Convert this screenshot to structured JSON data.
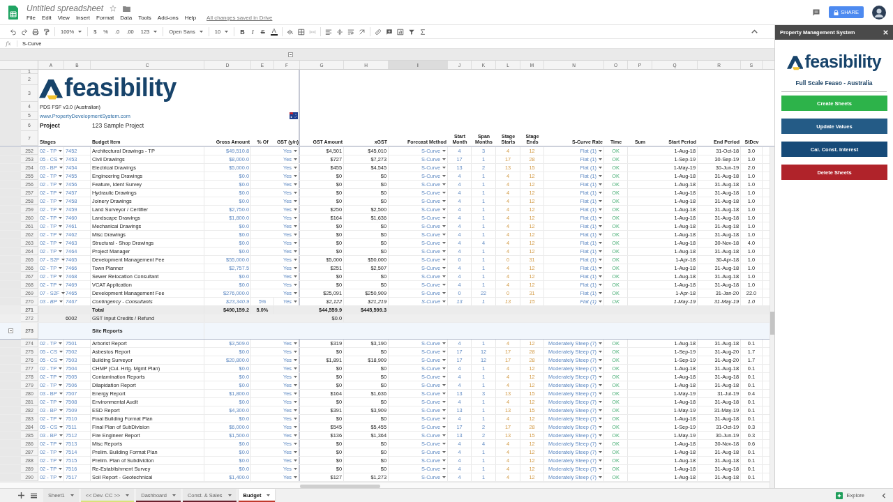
{
  "app": {
    "title": "Untitled spreadsheet",
    "menus": [
      "File",
      "Edit",
      "View",
      "Insert",
      "Format",
      "Data",
      "Tools",
      "Add-ons",
      "Help"
    ],
    "save_status": "All changes saved in Drive",
    "share": "SHARE"
  },
  "toolbar": [
    {
      "kind": "undo"
    },
    {
      "kind": "redo"
    },
    {
      "kind": "print"
    },
    {
      "kind": "paint-format"
    },
    {
      "kind": "sep"
    },
    {
      "kind": "menu",
      "label": "100%"
    },
    {
      "kind": "sep"
    },
    {
      "kind": "text",
      "label": "$"
    },
    {
      "kind": "text",
      "label": "%"
    },
    {
      "kind": "text",
      "label": ".0"
    },
    {
      "kind": "text",
      "label": ".00"
    },
    {
      "kind": "menu",
      "label": "123"
    },
    {
      "kind": "sep"
    },
    {
      "kind": "menu",
      "label": "Open Sans"
    },
    {
      "kind": "sep"
    },
    {
      "kind": "menu",
      "label": "10"
    },
    {
      "kind": "sep"
    },
    {
      "kind": "bold",
      "label": "B"
    },
    {
      "kind": "italic",
      "label": "I"
    },
    {
      "kind": "strike",
      "label": "S"
    },
    {
      "kind": "textcolor",
      "label": "A"
    },
    {
      "kind": "sep"
    },
    {
      "kind": "fill"
    },
    {
      "kind": "borders"
    },
    {
      "kind": "merge"
    },
    {
      "kind": "sep"
    },
    {
      "kind": "halign"
    },
    {
      "kind": "valign"
    },
    {
      "kind": "wrap"
    },
    {
      "kind": "rotate"
    },
    {
      "kind": "sep"
    },
    {
      "kind": "link"
    },
    {
      "kind": "comment"
    },
    {
      "kind": "chart"
    },
    {
      "kind": "filter"
    },
    {
      "kind": "functions"
    }
  ],
  "formula_bar": {
    "label": "fx",
    "value": "S-Curve"
  },
  "columns": [
    {
      "letter": "A",
      "kind": "input",
      "dropdown": true,
      "selected": false
    },
    {
      "letter": "B",
      "kind": "input",
      "dropdown": false,
      "selected": false
    },
    {
      "letter": "C",
      "kind": "plain",
      "dropdown": false,
      "selected": false
    },
    {
      "letter": "D",
      "kind": "input",
      "dropdown": false,
      "selected": false
    },
    {
      "letter": "E",
      "kind": "input",
      "dropdown": false,
      "selected": false
    },
    {
      "letter": "F",
      "kind": "input",
      "dropdown": true,
      "selected": false
    },
    {
      "letter": "G",
      "kind": "plain",
      "dropdown": false,
      "selected": false
    },
    {
      "letter": "H",
      "kind": "plain",
      "dropdown": false,
      "selected": false
    },
    {
      "letter": "I",
      "kind": "input",
      "dropdown": true,
      "selected": true
    },
    {
      "letter": "J",
      "kind": "input",
      "dropdown": false,
      "selected": false
    },
    {
      "letter": "K",
      "kind": "input",
      "dropdown": false,
      "selected": false
    },
    {
      "letter": "L",
      "kind": "stage",
      "dropdown": false,
      "selected": false
    },
    {
      "letter": "M",
      "kind": "stage",
      "dropdown": false,
      "selected": false
    },
    {
      "letter": "N",
      "kind": "input",
      "dropdown": true,
      "selected": false
    },
    {
      "letter": "O",
      "kind": "status",
      "dropdown": false,
      "selected": false
    },
    {
      "letter": "P",
      "selected": false
    },
    {
      "letter": "Q",
      "kind": "plain",
      "dropdown": false,
      "selected": false
    },
    {
      "letter": "R",
      "kind": "plain",
      "dropdown": false,
      "selected": false
    },
    {
      "letter": "S",
      "kind": "plain",
      "dropdown": false,
      "selected": false
    }
  ],
  "sheet_header": {
    "row_numbers": [
      "1",
      "2",
      "3",
      "4",
      "5",
      "6",
      "7"
    ],
    "logo": "feasibility",
    "version": "PDS FSF v3.0 (Australian)",
    "link": "www.PropertyDevelopmentSystem.com",
    "project_label": "Project",
    "project_name": "123 Sample Project",
    "headers": {
      "A": "Stages",
      "C": "Budget Item",
      "D": "Gross Amount",
      "E": "% Of",
      "F": "GST (y/n)",
      "G": "GST Amount",
      "H": "xGST",
      "I": "Forecast Method",
      "J": "Start Month",
      "K": "Span Months",
      "L": "Stage Starts",
      "M": "Stage Ends",
      "N": "S-Curve Rate",
      "O": "Time",
      "P": "Sum",
      "Q": "Start Period",
      "R": "End Period",
      "S": "StDev"
    }
  },
  "rows": [
    {
      "row": "252",
      "kind": "item",
      "italic": false,
      "cells": {
        "A": "02 - TP",
        "B": "7452",
        "C": "Architectural Drawings - TP",
        "D": "$49,510.8",
        "F": "Yes",
        "G": "$4,501",
        "H": "$45,010",
        "I": "S-Curve",
        "J": "4",
        "K": "3",
        "L": "4",
        "M": "12",
        "N": "Flat (1)",
        "O": "OK",
        "Q": "1-Aug-18",
        "R": "31-Oct-18",
        "S": "3.0"
      }
    },
    {
      "row": "253",
      "kind": "item",
      "italic": false,
      "cells": {
        "A": "05 - CS",
        "B": "7453",
        "C": "Civil Drawings",
        "D": "$8,000.0",
        "F": "Yes",
        "G": "$727",
        "H": "$7,273",
        "I": "S-Curve",
        "J": "17",
        "K": "1",
        "L": "17",
        "M": "28",
        "N": "Flat (1)",
        "O": "OK",
        "Q": "1-Sep-19",
        "R": "30-Sep-19",
        "S": "1.0"
      }
    },
    {
      "row": "254",
      "kind": "item",
      "italic": false,
      "cells": {
        "A": "03 - BP",
        "B": "7454",
        "C": "Electrical Drawings",
        "D": "$5,000.0",
        "F": "Yes",
        "G": "$455",
        "H": "$4,545",
        "I": "S-Curve",
        "J": "13",
        "K": "2",
        "L": "13",
        "M": "15",
        "N": "Flat (1)",
        "O": "OK",
        "Q": "1-May-19",
        "R": "30-Jun-19",
        "S": "2.0"
      }
    },
    {
      "row": "255",
      "kind": "item",
      "italic": false,
      "cells": {
        "A": "02 - TP",
        "B": "7455",
        "C": "Engineering Drawings",
        "D": "$0.0",
        "F": "Yes",
        "G": "$0",
        "H": "$0",
        "I": "S-Curve",
        "J": "4",
        "K": "1",
        "L": "4",
        "M": "12",
        "N": "Flat (1)",
        "O": "OK",
        "Q": "1-Aug-18",
        "R": "31-Aug-18",
        "S": "1.0"
      }
    },
    {
      "row": "256",
      "kind": "item",
      "italic": false,
      "cells": {
        "A": "02 - TP",
        "B": "7456",
        "C": "Feature, Ident Survey",
        "D": "$0.0",
        "F": "Yes",
        "G": "$0",
        "H": "$0",
        "I": "S-Curve",
        "J": "4",
        "K": "1",
        "L": "4",
        "M": "12",
        "N": "Flat (1)",
        "O": "OK",
        "Q": "1-Aug-18",
        "R": "31-Aug-18",
        "S": "1.0"
      }
    },
    {
      "row": "257",
      "kind": "item",
      "italic": false,
      "cells": {
        "A": "02 - TP",
        "B": "7457",
        "C": "Hydraulic Drawings",
        "D": "$0.0",
        "F": "Yes",
        "G": "$0",
        "H": "$0",
        "I": "S-Curve",
        "J": "4",
        "K": "1",
        "L": "4",
        "M": "12",
        "N": "Flat (1)",
        "O": "OK",
        "Q": "1-Aug-18",
        "R": "31-Aug-18",
        "S": "1.0"
      }
    },
    {
      "row": "258",
      "kind": "item",
      "italic": false,
      "cells": {
        "A": "02 - TP",
        "B": "7458",
        "C": "Joinery Drawings",
        "D": "$0.0",
        "F": "Yes",
        "G": "$0",
        "H": "$0",
        "I": "S-Curve",
        "J": "4",
        "K": "1",
        "L": "4",
        "M": "12",
        "N": "Flat (1)",
        "O": "OK",
        "Q": "1-Aug-18",
        "R": "31-Aug-18",
        "S": "1.0"
      }
    },
    {
      "row": "259",
      "kind": "item",
      "italic": false,
      "cells": {
        "A": "02 - TP",
        "B": "7459",
        "C": "Land Surveyor / Certifier",
        "D": "$2,750.0",
        "F": "Yes",
        "G": "$250",
        "H": "$2,500",
        "I": "S-Curve",
        "J": "4",
        "K": "1",
        "L": "4",
        "M": "12",
        "N": "Flat (1)",
        "O": "OK",
        "Q": "1-Aug-18",
        "R": "31-Aug-18",
        "S": "1.0"
      }
    },
    {
      "row": "260",
      "kind": "item",
      "italic": false,
      "cells": {
        "A": "02 - TP",
        "B": "7460",
        "C": "Landscape Drawings",
        "D": "$1,800.0",
        "F": "Yes",
        "G": "$164",
        "H": "$1,636",
        "I": "S-Curve",
        "J": "4",
        "K": "1",
        "L": "4",
        "M": "12",
        "N": "Flat (1)",
        "O": "OK",
        "Q": "1-Aug-18",
        "R": "31-Aug-18",
        "S": "1.0"
      }
    },
    {
      "row": "261",
      "kind": "item",
      "italic": false,
      "cells": {
        "A": "02 - TP",
        "B": "7461",
        "C": "Mechanical Drawings",
        "D": "$0.0",
        "F": "Yes",
        "G": "$0",
        "H": "$0",
        "I": "S-Curve",
        "J": "4",
        "K": "1",
        "L": "4",
        "M": "12",
        "N": "Flat (1)",
        "O": "OK",
        "Q": "1-Aug-18",
        "R": "31-Aug-18",
        "S": "1.0"
      }
    },
    {
      "row": "262",
      "kind": "item",
      "italic": false,
      "cells": {
        "A": "02 - TP",
        "B": "7462",
        "C": "Misc Drawings",
        "D": "$0.0",
        "F": "Yes",
        "G": "$0",
        "H": "$0",
        "I": "S-Curve",
        "J": "4",
        "K": "1",
        "L": "4",
        "M": "12",
        "N": "Flat (1)",
        "O": "OK",
        "Q": "1-Aug-18",
        "R": "31-Aug-18",
        "S": "1.0"
      }
    },
    {
      "row": "263",
      "kind": "item",
      "italic": false,
      "cells": {
        "A": "02 - TP",
        "B": "7463",
        "C": "Structural - Shop Drawings",
        "D": "$0.0",
        "F": "Yes",
        "G": "$0",
        "H": "$0",
        "I": "S-Curve",
        "J": "4",
        "K": "4",
        "L": "4",
        "M": "12",
        "N": "Flat (1)",
        "O": "OK",
        "Q": "1-Aug-18",
        "R": "30-Nov-18",
        "S": "4.0"
      }
    },
    {
      "row": "264",
      "kind": "item",
      "italic": false,
      "cells": {
        "A": "02 - TP",
        "B": "7464",
        "C": "Project Manager",
        "D": "$0.0",
        "F": "Yes",
        "G": "$0",
        "H": "$0",
        "I": "S-Curve",
        "J": "4",
        "K": "1",
        "L": "4",
        "M": "12",
        "N": "Flat (1)",
        "O": "OK",
        "Q": "1-Aug-18",
        "R": "31-Aug-18",
        "S": "1.0"
      }
    },
    {
      "row": "265",
      "kind": "item",
      "italic": false,
      "cells": {
        "A": "07 - S2F",
        "B": "7465",
        "C": "Development Management Fee",
        "D": "$55,000.0",
        "F": "Yes",
        "G": "$5,000",
        "H": "$50,000",
        "I": "S-Curve",
        "J": "0",
        "K": "1",
        "L": "0",
        "M": "31",
        "N": "Flat (1)",
        "O": "OK",
        "Q": "1-Apr-18",
        "R": "30-Apr-18",
        "S": "1.0"
      }
    },
    {
      "row": "266",
      "kind": "item",
      "italic": false,
      "cells": {
        "A": "02 - TP",
        "B": "7466",
        "C": "Town Planner",
        "D": "$2,757.5",
        "F": "Yes",
        "G": "$251",
        "H": "$2,507",
        "I": "S-Curve",
        "J": "4",
        "K": "1",
        "L": "4",
        "M": "12",
        "N": "Flat (1)",
        "O": "OK",
        "Q": "1-Aug-18",
        "R": "31-Aug-18",
        "S": "1.0"
      }
    },
    {
      "row": "267",
      "kind": "item",
      "italic": false,
      "cells": {
        "A": "02 - TP",
        "B": "7468",
        "C": "Sewer Relocation Consultant",
        "D": "$0.0",
        "F": "Yes",
        "G": "$0",
        "H": "$0",
        "I": "S-Curve",
        "J": "4",
        "K": "1",
        "L": "4",
        "M": "12",
        "N": "Flat (1)",
        "O": "OK",
        "Q": "1-Aug-18",
        "R": "31-Aug-18",
        "S": "1.0"
      }
    },
    {
      "row": "268",
      "kind": "item",
      "italic": false,
      "cells": {
        "A": "02 - TP",
        "B": "7469",
        "C": "VCAT Application",
        "D": "$0.0",
        "F": "Yes",
        "G": "$0",
        "H": "$0",
        "I": "S-Curve",
        "J": "4",
        "K": "1",
        "L": "4",
        "M": "12",
        "N": "Flat (1)",
        "O": "OK",
        "Q": "1-Aug-18",
        "R": "31-Aug-18",
        "S": "1.0"
      }
    },
    {
      "row": "269",
      "kind": "item",
      "italic": false,
      "cells": {
        "A": "07 - S2F",
        "B": "7465",
        "C": "Development Management Fee",
        "D": "$276,000.0",
        "F": "Yes",
        "G": "$25,091",
        "H": "$250,909",
        "I": "S-Curve",
        "J": "0",
        "K": "22",
        "L": "0",
        "M": "31",
        "N": "Flat (1)",
        "O": "OK",
        "Q": "1-Apr-18",
        "R": "31-Jan-20",
        "S": "22.0"
      }
    },
    {
      "row": "270",
      "kind": "item",
      "italic": true,
      "cells": {
        "A": "03 - BP",
        "B": "7467",
        "C": "Contingency - Consultants",
        "D": "$23,340.9",
        "E": "5%",
        "F": "Yes",
        "G": "$2,122",
        "H": "$21,219",
        "I": "S-Curve",
        "J": "13",
        "K": "1",
        "L": "13",
        "M": "15",
        "N": "Flat (1)",
        "O": "OK",
        "Q": "1-May-19",
        "R": "31-May-19",
        "S": "1.0"
      }
    },
    {
      "row": "271",
      "kind": "total",
      "cells": {
        "C": "Total",
        "D": "$490,159.2",
        "E": "5.0%",
        "G": "$44,559.9",
        "H": "$445,599.3"
      }
    },
    {
      "row": "272",
      "kind": "gst",
      "cells": {
        "B": "6002",
        "C": "GST Input Credits / Refund",
        "G": "$0.0"
      }
    },
    {
      "row": "273",
      "kind": "section",
      "cells": {
        "C": "Site Reports"
      }
    },
    {
      "row": "274",
      "kind": "item",
      "italic": false,
      "cells": {
        "A": "02 - TP",
        "B": "7501",
        "C": "Arborist Report",
        "D": "$3,509.0",
        "F": "Yes",
        "G": "$319",
        "H": "$3,190",
        "I": "S-Curve",
        "J": "4",
        "K": "1",
        "L": "4",
        "M": "12",
        "N": "Moderately Steep (7)",
        "O": "OK",
        "Q": "1-Aug-18",
        "R": "31-Aug-18",
        "S": "0.1"
      }
    },
    {
      "row": "275",
      "kind": "item",
      "italic": false,
      "cells": {
        "A": "05 - CS",
        "B": "7502",
        "C": "Asbestos Report",
        "D": "$0.0",
        "F": "Yes",
        "G": "$0",
        "H": "$0",
        "I": "S-Curve",
        "J": "17",
        "K": "12",
        "L": "17",
        "M": "28",
        "N": "Moderately Steep (7)",
        "O": "OK",
        "Q": "1-Sep-19",
        "R": "31-Aug-20",
        "S": "1.7"
      }
    },
    {
      "row": "276",
      "kind": "item",
      "italic": false,
      "cells": {
        "A": "05 - CS",
        "B": "7503",
        "C": "Building Surveyor",
        "D": "$20,800.0",
        "F": "Yes",
        "G": "$1,891",
        "H": "$18,909",
        "I": "S-Curve",
        "J": "17",
        "K": "12",
        "L": "17",
        "M": "28",
        "N": "Moderately Steep (7)",
        "O": "OK",
        "Q": "1-Sep-19",
        "R": "31-Aug-20",
        "S": "1.7"
      }
    },
    {
      "row": "277",
      "kind": "item",
      "italic": false,
      "cells": {
        "A": "02 - TP",
        "B": "7504",
        "C": "CHMP (Cul. Hrtg. Mgmt Plan)",
        "D": "$0.0",
        "F": "Yes",
        "G": "$0",
        "H": "$0",
        "I": "S-Curve",
        "J": "4",
        "K": "1",
        "L": "4",
        "M": "12",
        "N": "Moderately Steep (7)",
        "O": "OK",
        "Q": "1-Aug-18",
        "R": "31-Aug-18",
        "S": "0.1"
      }
    },
    {
      "row": "278",
      "kind": "item",
      "italic": false,
      "cells": {
        "A": "02 - TP",
        "B": "7505",
        "C": "Contamination Reports",
        "D": "$0.0",
        "F": "Yes",
        "G": "$0",
        "H": "$0",
        "I": "S-Curve",
        "J": "4",
        "K": "1",
        "L": "4",
        "M": "12",
        "N": "Moderately Steep (7)",
        "O": "OK",
        "Q": "1-Aug-18",
        "R": "31-Aug-18",
        "S": "0.1"
      }
    },
    {
      "row": "279",
      "kind": "item",
      "italic": false,
      "cells": {
        "A": "02 - TP",
        "B": "7506",
        "C": "Dilapidation Report",
        "D": "$0.0",
        "F": "Yes",
        "G": "$0",
        "H": "$0",
        "I": "S-Curve",
        "J": "4",
        "K": "1",
        "L": "4",
        "M": "12",
        "N": "Moderately Steep (7)",
        "O": "OK",
        "Q": "1-Aug-18",
        "R": "31-Aug-18",
        "S": "0.1"
      }
    },
    {
      "row": "280",
      "kind": "item",
      "italic": false,
      "cells": {
        "A": "03 - BP",
        "B": "7507",
        "C": "Energy Report",
        "D": "$1,800.0",
        "F": "Yes",
        "G": "$164",
        "H": "$1,636",
        "I": "S-Curve",
        "J": "13",
        "K": "3",
        "L": "13",
        "M": "15",
        "N": "Moderately Steep (7)",
        "O": "OK",
        "Q": "1-May-19",
        "R": "31-Jul-19",
        "S": "0.4"
      }
    },
    {
      "row": "281",
      "kind": "item",
      "italic": false,
      "cells": {
        "A": "02 - TP",
        "B": "7508",
        "C": "Environmental Audit",
        "D": "$0.0",
        "F": "Yes",
        "G": "$0",
        "H": "$0",
        "I": "S-Curve",
        "J": "4",
        "K": "1",
        "L": "4",
        "M": "12",
        "N": "Moderately Steep (7)",
        "O": "OK",
        "Q": "1-Aug-18",
        "R": "31-Aug-18",
        "S": "0.1"
      }
    },
    {
      "row": "282",
      "kind": "item",
      "italic": false,
      "cells": {
        "A": "03 - BP",
        "B": "7509",
        "C": "ESD Report",
        "D": "$4,300.0",
        "F": "Yes",
        "G": "$391",
        "H": "$3,909",
        "I": "S-Curve",
        "J": "13",
        "K": "1",
        "L": "13",
        "M": "15",
        "N": "Moderately Steep (7)",
        "O": "OK",
        "Q": "1-May-19",
        "R": "31-May-19",
        "S": "0.1"
      }
    },
    {
      "row": "283",
      "kind": "item",
      "italic": false,
      "cells": {
        "A": "02 - TP",
        "B": "7510",
        "C": "Final Building Format Plan",
        "D": "$0.0",
        "F": "Yes",
        "G": "$0",
        "H": "$0",
        "I": "S-Curve",
        "J": "4",
        "K": "1",
        "L": "4",
        "M": "12",
        "N": "Moderately Steep (7)",
        "O": "OK",
        "Q": "1-Aug-18",
        "R": "31-Aug-18",
        "S": "0.1"
      }
    },
    {
      "row": "284",
      "kind": "item",
      "italic": false,
      "cells": {
        "A": "05 - CS",
        "B": "7511",
        "C": "Final Plan of SubDivision",
        "D": "$6,000.0",
        "F": "Yes",
        "G": "$545",
        "H": "$5,455",
        "I": "S-Curve",
        "J": "17",
        "K": "2",
        "L": "17",
        "M": "28",
        "N": "Moderately Steep (7)",
        "O": "OK",
        "Q": "1-Sep-19",
        "R": "31-Oct-19",
        "S": "0.3"
      }
    },
    {
      "row": "285",
      "kind": "item",
      "italic": false,
      "cells": {
        "A": "03 - BP",
        "B": "7512",
        "C": "Fire Engineer Report",
        "D": "$1,500.0",
        "F": "Yes",
        "G": "$136",
        "H": "$1,364",
        "I": "S-Curve",
        "J": "13",
        "K": "2",
        "L": "13",
        "M": "15",
        "N": "Moderately Steep (7)",
        "O": "OK",
        "Q": "1-May-19",
        "R": "30-Jun-19",
        "S": "0.3"
      }
    },
    {
      "row": "286",
      "kind": "item",
      "italic": false,
      "cells": {
        "A": "02 - TP",
        "B": "7513",
        "C": "Misc Reports",
        "D": "$0.0",
        "F": "Yes",
        "G": "$0",
        "H": "$0",
        "I": "S-Curve",
        "J": "4",
        "K": "4",
        "L": "4",
        "M": "12",
        "N": "Moderately Steep (7)",
        "O": "OK",
        "Q": "1-Aug-18",
        "R": "30-Nov-18",
        "S": "0.6"
      }
    },
    {
      "row": "287",
      "kind": "item",
      "italic": false,
      "cells": {
        "A": "02 - TP",
        "B": "7514",
        "C": "Prelim. Building Format Plan",
        "D": "$0.0",
        "F": "Yes",
        "G": "$0",
        "H": "$0",
        "I": "S-Curve",
        "J": "4",
        "K": "1",
        "L": "4",
        "M": "12",
        "N": "Moderately Steep (7)",
        "O": "OK",
        "Q": "1-Aug-18",
        "R": "31-Aug-18",
        "S": "0.1"
      }
    },
    {
      "row": "288",
      "kind": "item",
      "italic": false,
      "cells": {
        "A": "02 - TP",
        "B": "7515",
        "C": "Prelim. Plan of Subdividion",
        "D": "$0.0",
        "F": "Yes",
        "G": "$0",
        "H": "$0",
        "I": "S-Curve",
        "J": "4",
        "K": "1",
        "L": "4",
        "M": "12",
        "N": "Moderately Steep (7)",
        "O": "OK",
        "Q": "1-Aug-18",
        "R": "31-Aug-18",
        "S": "0.1"
      }
    },
    {
      "row": "289",
      "kind": "item",
      "italic": false,
      "cells": {
        "A": "02 - TP",
        "B": "7516",
        "C": "Re-Establishment Survey",
        "D": "$0.0",
        "F": "Yes",
        "G": "$0",
        "H": "$0",
        "I": "S-Curve",
        "J": "4",
        "K": "1",
        "L": "4",
        "M": "12",
        "N": "Moderately Steep (7)",
        "O": "OK",
        "Q": "1-Aug-18",
        "R": "31-Aug-18",
        "S": "0.1"
      }
    },
    {
      "row": "290",
      "kind": "item",
      "italic": false,
      "cells": {
        "A": "02 - TP",
        "B": "7517",
        "C": "Soil Report - Geotechnical",
        "D": "$1,400.0",
        "F": "Yes",
        "G": "$127",
        "H": "$1,273",
        "I": "S-Curve",
        "J": "4",
        "K": "1",
        "L": "4",
        "M": "12",
        "N": "Moderately Steep (7)",
        "O": "OK",
        "Q": "1-Aug-18",
        "R": "31-Aug-18",
        "S": "0.1"
      }
    }
  ],
  "sheet_tabs": [
    {
      "label": "Sheet1",
      "selected": false
    },
    {
      "label": "<< Dev. CC >>",
      "selected": false,
      "color": "#d9e27a"
    },
    {
      "label": "Dashboard",
      "selected": false,
      "color": "#6b1f2c"
    },
    {
      "label": "Const. & Sales",
      "selected": false,
      "color": "#6b1f2c"
    },
    {
      "label": "Budget",
      "selected": true,
      "color": "#c0392b"
    }
  ],
  "explore": "Explore",
  "sidebar": {
    "title": "Property Management System",
    "logo": "feasibility",
    "subtitle": "Full Scale Feaso - Australia",
    "buttons": [
      {
        "label": "Create Sheets",
        "color": "#2db34a"
      },
      {
        "label": "Update Values",
        "color": "#245b86"
      },
      {
        "label": "Cal. Const. Interest",
        "color": "#164a78"
      },
      {
        "label": "Delete Sheets",
        "color": "#b0232a"
      }
    ]
  }
}
